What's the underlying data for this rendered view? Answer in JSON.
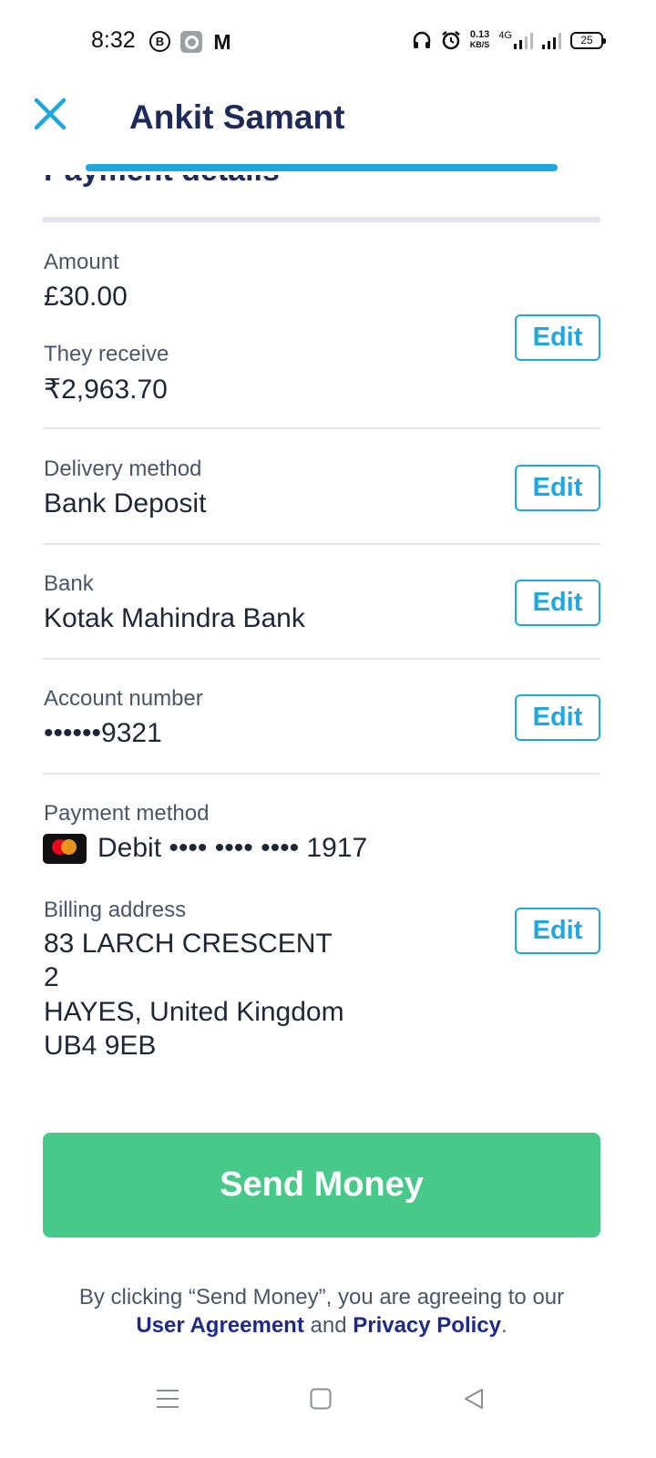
{
  "status_bar": {
    "time": "8:32",
    "b_icon_letter": "B",
    "m_icon_letter": "M",
    "net_speed_top": "0.13",
    "net_speed_bottom": "KB/S",
    "network": "4G",
    "battery": "25"
  },
  "header": {
    "title": "Ankit Samant",
    "progress_fraction": 1.0
  },
  "section_heading": "Payment details",
  "fields": {
    "amount": {
      "label": "Amount",
      "value": "£30.00"
    },
    "they_receive": {
      "label": "They receive",
      "value": "₹2,963.70"
    },
    "delivery_method": {
      "label": "Delivery method",
      "value": "Bank Deposit"
    },
    "bank": {
      "label": "Bank",
      "value": "Kotak Mahindra Bank"
    },
    "account_number": {
      "label": "Account number",
      "value": "••••••9321"
    },
    "payment_method": {
      "label": "Payment method",
      "value": "Debit •••• •••• •••• 1917",
      "card_brand_icon": "mastercard-icon"
    },
    "billing_address": {
      "label": "Billing address",
      "lines": [
        "83 LARCH CRESCENT",
        "2",
        "HAYES, United Kingdom",
        "UB4 9EB"
      ]
    }
  },
  "edit_label": "Edit",
  "send_button_label": "Send Money",
  "legal": {
    "prefix": "By clicking “Send Money”, you are agreeing to our",
    "user_agreement": "User Agreement",
    "and": "and",
    "privacy_policy": "Privacy Policy",
    "suffix": "."
  },
  "colors": {
    "accent": "#1fa7e0",
    "title": "#1d2a5a",
    "send_button": "#47c989",
    "link": "#1d2a8c"
  },
  "nav_icons": [
    "menu-icon",
    "home-square-icon",
    "back-triangle-icon"
  ]
}
